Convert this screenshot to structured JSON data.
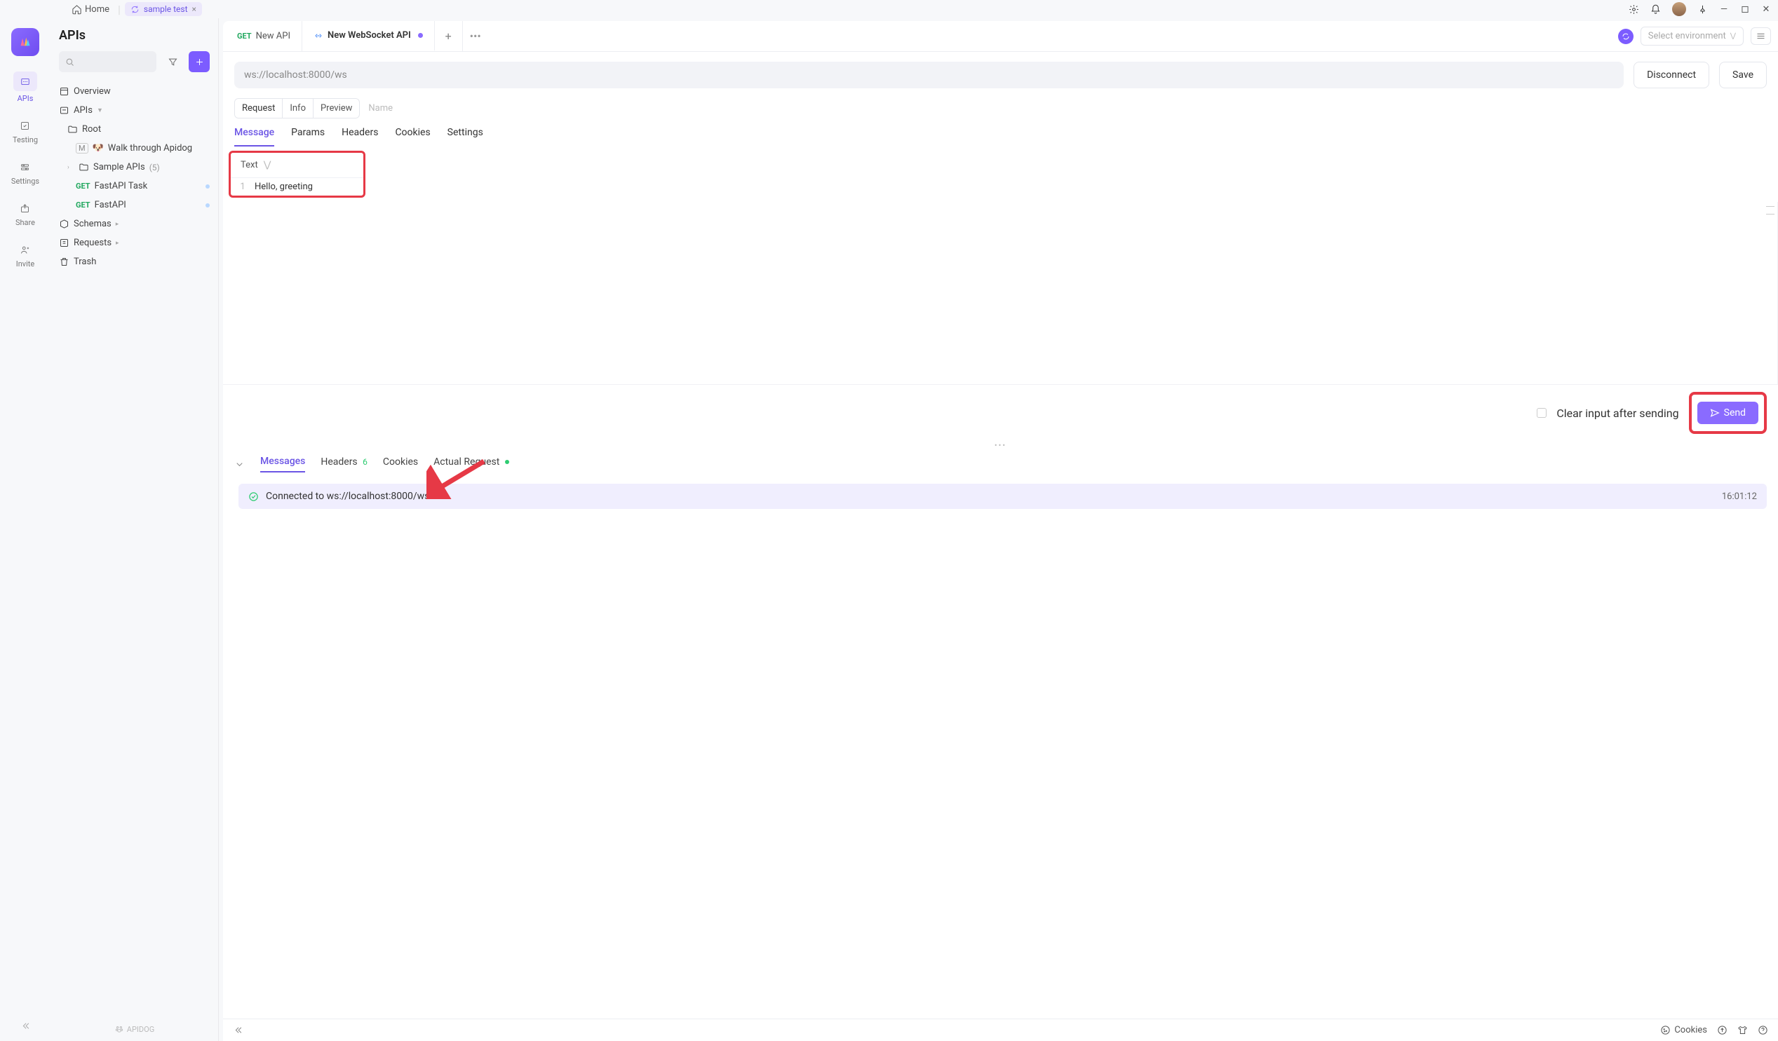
{
  "titlebar": {
    "home": "Home",
    "project_tab": "sample test"
  },
  "rail": {
    "items": [
      {
        "label": "APIs"
      },
      {
        "label": "Testing"
      },
      {
        "label": "Settings"
      },
      {
        "label": "Share"
      },
      {
        "label": "Invite"
      }
    ]
  },
  "panel": {
    "title": "APIs",
    "overview": "Overview",
    "apis": "APIs",
    "root": "Root",
    "walkthrough": "Walk through Apidog",
    "sample": "Sample APIs",
    "sample_count": "(5)",
    "fastapi_task": "FastAPI Task",
    "fastapi": "FastAPI",
    "schemas": "Schemas",
    "requests": "Requests",
    "trash": "Trash",
    "brand": "APIDOG"
  },
  "methods": {
    "get": "GET"
  },
  "tabs": {
    "t1": "New API",
    "t2": "New WebSocket API"
  },
  "toolbar": {
    "env_placeholder": "Select environment",
    "disconnect": "Disconnect",
    "save": "Save"
  },
  "url": {
    "value": "ws://localhost:8000/ws"
  },
  "reqtabs": {
    "request": "Request",
    "info": "Info",
    "preview": "Preview",
    "name": "Name"
  },
  "msgtabs": {
    "message": "Message",
    "params": "Params",
    "headers": "Headers",
    "cookies": "Cookies",
    "settings": "Settings"
  },
  "editor": {
    "type": "Text",
    "line1_no": "1",
    "line1": "Hello, greeting"
  },
  "sendrow": {
    "clear": "Clear input after sending",
    "send": "Send"
  },
  "resp": {
    "messages": "Messages",
    "headers": "Headers",
    "headers_count": "6",
    "cookies": "Cookies",
    "actual": "Actual Request",
    "connected": "Connected to ws://localhost:8000/ws",
    "time": "16:01:12"
  },
  "status": {
    "cookies": "Cookies"
  }
}
